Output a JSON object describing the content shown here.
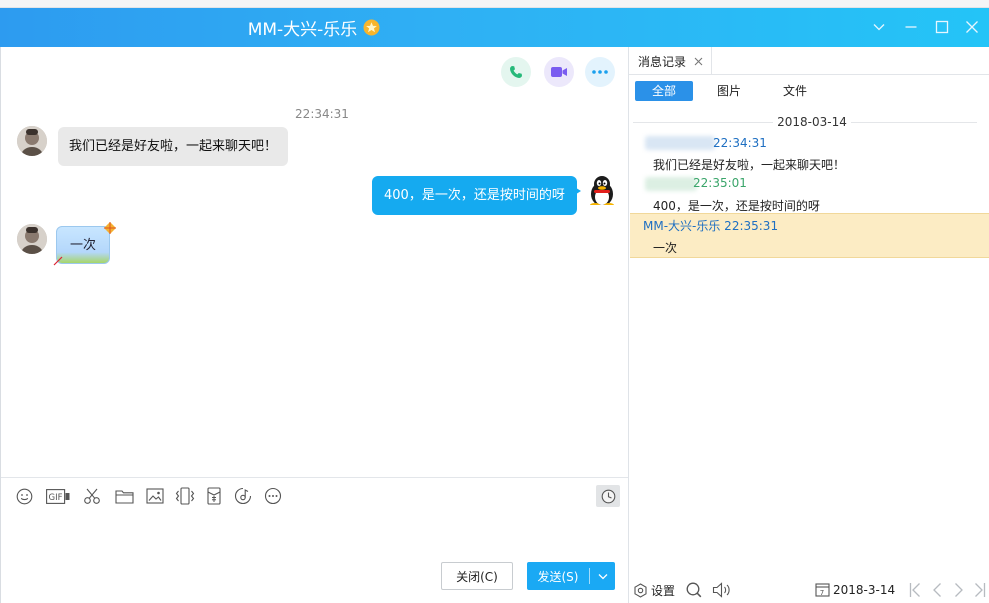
{
  "window": {
    "title": "MM-大兴-乐乐"
  },
  "chat": {
    "timestamp": "22:34:31",
    "messages": [
      {
        "direction": "incoming",
        "text": "我们已经是好友啦，一起来聊天吧！"
      },
      {
        "direction": "outgoing",
        "text": "400，是一次，还是按时间的呀"
      },
      {
        "direction": "incoming",
        "text": "一次"
      }
    ]
  },
  "footer": {
    "close_label": "关闭(C)",
    "send_label": "发送(S)"
  },
  "history": {
    "tab_label": "消息记录",
    "filters": [
      "全部",
      "图片",
      "文件"
    ],
    "date": "2018-03-14",
    "entries": [
      {
        "sender_time": "22:34:31",
        "text": "我们已经是好友啦，一起来聊天吧！"
      },
      {
        "sender_time": "22:35:01",
        "text": "400，是一次，还是按时间的呀"
      },
      {
        "sender_time": "MM-大兴-乐乐 22:35:31",
        "text": "一次"
      }
    ],
    "settings_label": "设置",
    "date_picker_value": "2018-3-14"
  },
  "colors": {
    "accent": "#1aa9f4",
    "title_gradient_start": "#2d9bf0",
    "title_gradient_end": "#24c4f7",
    "highlight": "#fcecc4",
    "history_time_blue": "#1e6fc2",
    "history_time_green": "#3aa56a"
  },
  "icons": {
    "title_badge": "star-badge-icon",
    "voice_call": "phone-icon",
    "video_call": "video-camera-icon",
    "more": "more-dots-icon",
    "toolbar": [
      "emoji-icon",
      "gif-icon",
      "screenshot-scissors-icon",
      "folder-icon",
      "image-icon",
      "shake-icon",
      "red-packet-icon",
      "music-icon",
      "more-icon",
      "history-clock-icon"
    ]
  }
}
